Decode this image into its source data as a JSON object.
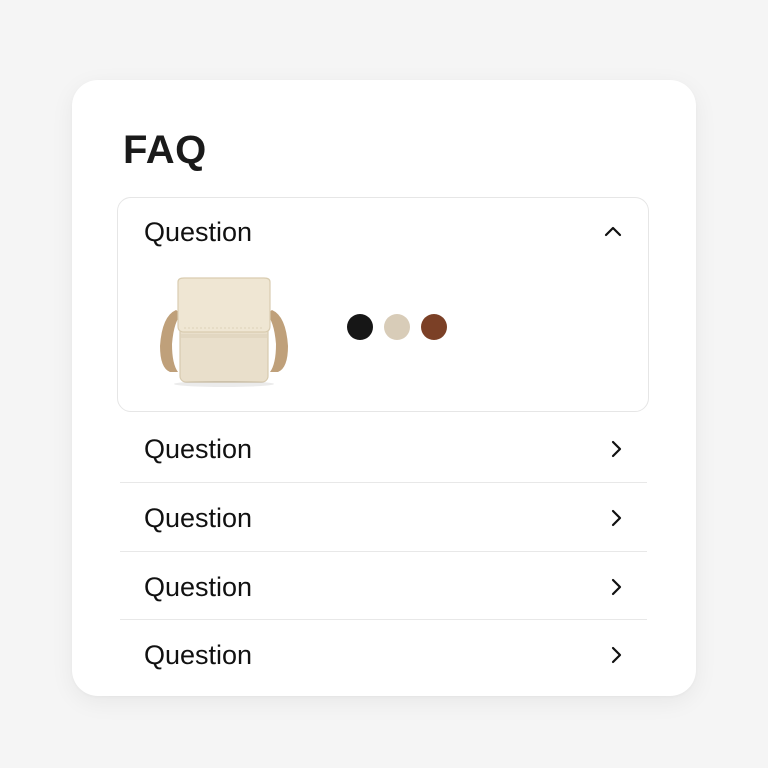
{
  "faq": {
    "title": "FAQ",
    "open_item": {
      "question": "Question",
      "icon": "chevron-up-icon",
      "image": "crossbody-bag-image",
      "swatches": [
        {
          "name": "black",
          "color": "#161616"
        },
        {
          "name": "beige",
          "color": "#d8ccb8"
        },
        {
          "name": "brown",
          "color": "#7b4026"
        }
      ]
    },
    "items": [
      {
        "question": "Question",
        "icon": "chevron-right-icon"
      },
      {
        "question": "Question",
        "icon": "chevron-right-icon"
      },
      {
        "question": "Question",
        "icon": "chevron-right-icon"
      },
      {
        "question": "Question",
        "icon": "chevron-right-icon"
      }
    ]
  },
  "colors": {
    "background": "#f5f5f5",
    "card": "#ffffff",
    "text": "#111111",
    "divider": "#e8e8e8"
  }
}
